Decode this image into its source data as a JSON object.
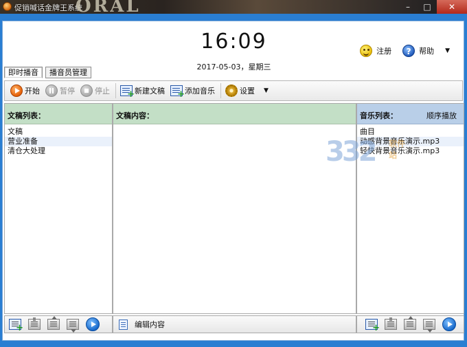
{
  "window": {
    "title": "促销喊话金牌王系统",
    "deco_text": "ORAL"
  },
  "header": {
    "time": "16:09",
    "date": "2017-05-03，星期三",
    "register_label": "注册",
    "help_label": "帮助"
  },
  "tabs": [
    {
      "label": "即时播音",
      "active": true
    },
    {
      "label": "播音员管理",
      "active": false
    }
  ],
  "toolbar": {
    "start_label": "开始",
    "pause_label": "暂停",
    "stop_label": "停止",
    "new_script_label": "新建文稿",
    "add_music_label": "添加音乐",
    "settings_label": "设置"
  },
  "scripts_panel": {
    "title": "文稿列表：",
    "column_header": "文稿",
    "items": [
      "营业准备",
      "清仓大处理"
    ]
  },
  "content_panel": {
    "title": "文稿内容："
  },
  "music_panel": {
    "title": "音乐列表：",
    "mode": "顺序播放",
    "column_header": "曲目",
    "items": [
      "动感背景音乐演示.mp3",
      "轻快背景音乐演示.mp3"
    ]
  },
  "bottom": {
    "edit_content_label": "编辑内容"
  },
  "watermark": {
    "number": "332",
    "text": "软件站"
  }
}
